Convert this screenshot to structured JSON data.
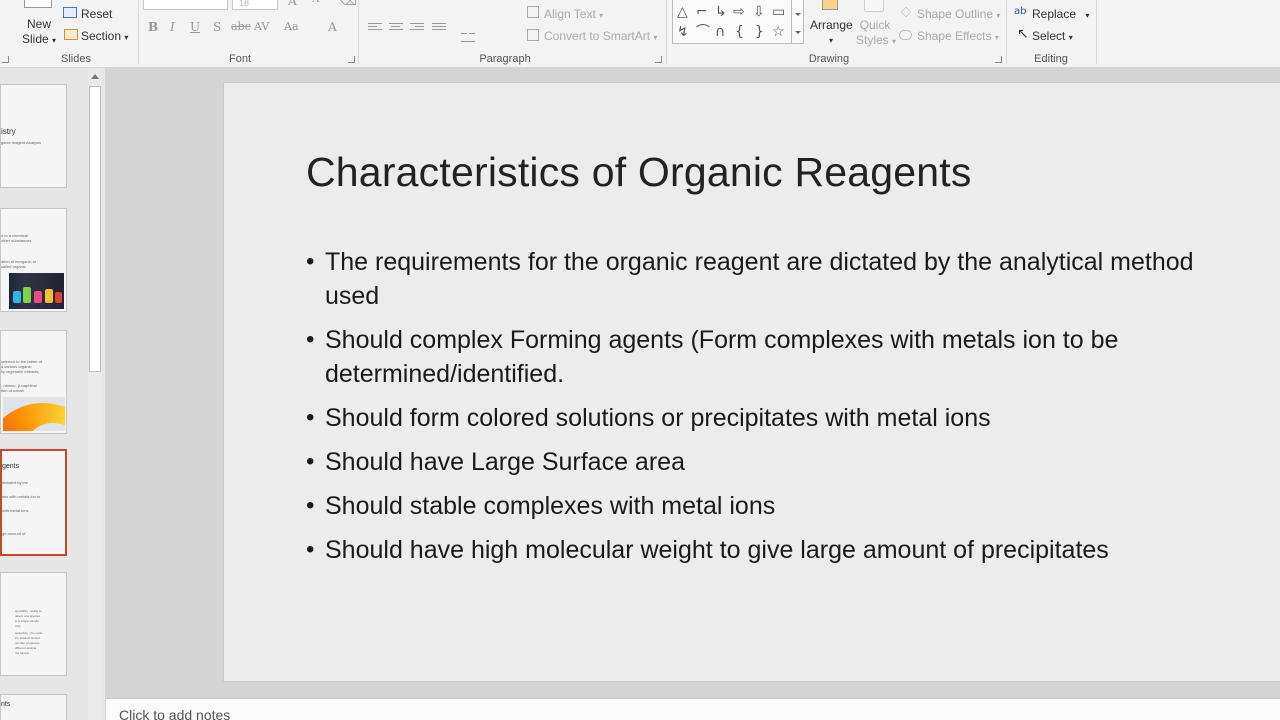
{
  "ribbon": {
    "slides_group": {
      "new_slide_line1": "New",
      "new_slide_line2": "Slide",
      "reset": "Reset",
      "section": "Section",
      "label": "Slides"
    },
    "font_group": {
      "font_size": "18",
      "bold": "B",
      "italic": "I",
      "underline": "U",
      "shadow": "S",
      "strike": "abc",
      "spacing": "AV",
      "case": "Aa",
      "font_color": "A",
      "label": "Font"
    },
    "paragraph_group": {
      "align_text": "Align Text",
      "convert_smartart": "Convert to SmartArt",
      "label": "Paragraph"
    },
    "drawing_group": {
      "arrange": "Arrange",
      "quick_styles_line1": "Quick",
      "quick_styles_line2": "Styles",
      "shape_outline": "Shape Outline",
      "shape_effects": "Shape Effects",
      "label": "Drawing"
    },
    "editing_group": {
      "replace": "Replace",
      "select": "Select",
      "label": "Editing"
    }
  },
  "thumbnails": [
    {
      "title": "istry",
      "lines": [
        "ganic reagent Analysis"
      ]
    },
    {
      "title": "",
      "lines": [
        "d to a chemical",
        "other substances.",
        "",
        "ation of inorganic or",
        "called organic"
      ]
    },
    {
      "title": "",
      "lines": [
        "referred to the father of",
        "d various organic",
        "lly vegetable extracts;",
        "",
        "- nitroso- β-naphthol",
        "tion of cobalt"
      ]
    },
    {
      "title": "gents",
      "lines": [
        "dictated by the",
        "",
        "xes with metals ion to",
        "",
        "with metal ions",
        "",
        "ge amount of"
      ]
    },
    {
      "title": "",
      "lines": [
        "specificity : ability to",
        "detect one species",
        "in a single sample",
        "only",
        "",
        "selectivity : the react",
        "ion towards limited",
        "number of species",
        "different analyte",
        "the sample"
      ]
    },
    {
      "title": "nts",
      "lines": []
    }
  ],
  "slide": {
    "title": "Characteristics of Organic Reagents",
    "bullets": [
      "The requirements for the organic reagent are dictated by the analytical method used",
      "Should complex Forming agents (Form complexes with metals ion to be determined/identified.",
      "Should  form colored solutions or precipitates with metal ions",
      "Should  have Large Surface area",
      "Should stable complexes with metal ions",
      "Should have high molecular weight to give large amount of precipitates"
    ]
  },
  "notes": {
    "placeholder": "Click to add notes"
  },
  "colors": {
    "selected_thumb_border": "#c8472c",
    "slide_bg": "#ececec"
  }
}
